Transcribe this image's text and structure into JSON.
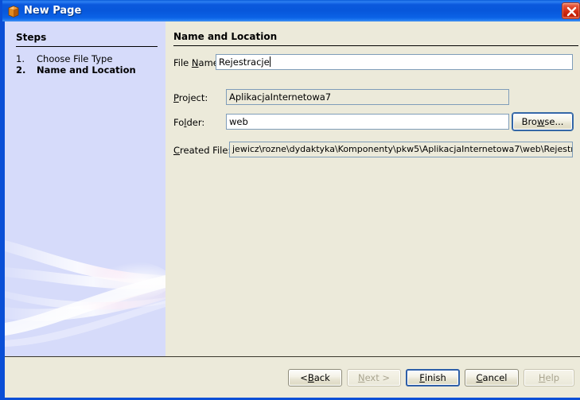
{
  "window": {
    "title": "New Page",
    "icon": "new-page-icon",
    "close_label": "×",
    "accent_blue": "#0A4FD6",
    "panel_bg": "#ECEADA",
    "steps_bg": "#D6DBFA"
  },
  "steps": {
    "heading": "Steps",
    "items": [
      {
        "num": "1.",
        "label": "Choose File Type",
        "active": false
      },
      {
        "num": "2.",
        "label": "Name and Location",
        "active": true
      }
    ]
  },
  "main": {
    "heading": "Name and Location",
    "fields": [
      {
        "label_pre": "File ",
        "label_mn": "N",
        "label_post": "ame:",
        "value": "Rejestracje",
        "disabled": false,
        "focused": true
      },
      {
        "label_pre": "",
        "label_mn": "P",
        "label_post": "roject:",
        "value": "AplikacjaInternetowa7",
        "disabled": true,
        "focused": false
      },
      {
        "label_pre": "Fo",
        "label_mn": "l",
        "label_post": "der:",
        "value": "web",
        "disabled": false,
        "focused": false
      },
      {
        "label_pre": "",
        "label_mn": "C",
        "label_post": "reated File:",
        "value": "jewicz\\rozne\\dydaktyka\\Komponenty\\pkw5\\AplikacjaInternetowa7\\web\\Rejestracje.jsp",
        "disabled": true,
        "focused": false
      }
    ],
    "browse": {
      "pre": "Bro",
      "mn": "w",
      "post": "se..."
    }
  },
  "buttons": {
    "back": {
      "pre": "< ",
      "mn": "B",
      "post": "ack",
      "state": "enabled"
    },
    "next": {
      "pre": "",
      "mn": "N",
      "post": "ext >",
      "state": "disabled"
    },
    "finish": {
      "pre": "",
      "mn": "F",
      "post": "inish",
      "state": "default"
    },
    "cancel": {
      "pre": "",
      "mn": "C",
      "post": "ancel",
      "state": "enabled"
    },
    "help": {
      "pre": "",
      "mn": "H",
      "post": "elp",
      "state": "disabled"
    }
  }
}
